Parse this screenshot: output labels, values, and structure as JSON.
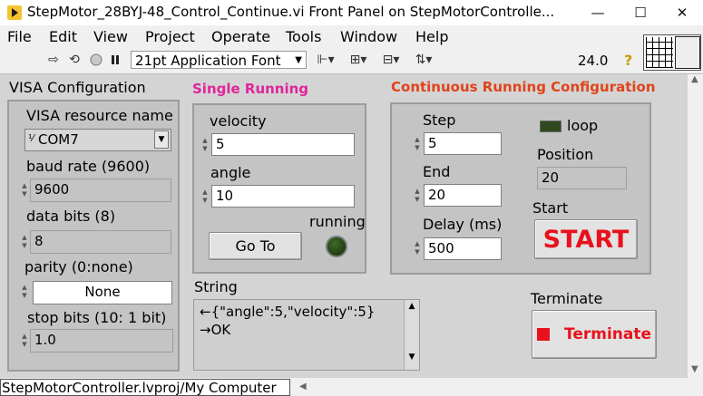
{
  "window": {
    "title": "StepMotor_28BYJ-48_Control_Continue.vi Front Panel on StepMotorControlle...",
    "minimize": "—",
    "maximize": "☐",
    "close": "✕"
  },
  "menu": [
    "File",
    "Edit",
    "View",
    "Project",
    "Operate",
    "Tools",
    "Window",
    "Help"
  ],
  "toolbar": {
    "font": "21pt Application Font",
    "version": "24.0",
    "help": "?"
  },
  "visa": {
    "title": "VISA Configuration",
    "resource_label": "VISA resource name",
    "resource_value": "COM7",
    "baud_label": "baud rate (9600)",
    "baud_value": "9600",
    "databits_label": "data bits (8)",
    "databits_value": "8",
    "parity_label": "parity (0:none)",
    "parity_value": "None",
    "stopbits_label": "stop bits (10: 1 bit)",
    "stopbits_value": "1.0"
  },
  "single": {
    "title": "Single Running",
    "velocity_label": "velocity",
    "velocity_value": "5",
    "angle_label": "angle",
    "angle_value": "10",
    "goto_label": "Go To",
    "running_label": "running"
  },
  "continuous": {
    "title": "Continuous Running Configuration",
    "step_label": "Step",
    "step_value": "5",
    "end_label": "End",
    "end_value": "20",
    "delay_label": "Delay (ms)",
    "delay_value": "500",
    "loop_label": "loop",
    "position_label": "Position",
    "position_value": "20",
    "start_caption": "Start",
    "start_label": "START"
  },
  "string": {
    "label": "String",
    "line1": "←{\"angle\":5,\"velocity\":5}",
    "line2": "→OK"
  },
  "terminate": {
    "caption": "Terminate",
    "label": "Terminate"
  },
  "status": {
    "path": "StepMotorController.lvproj/My Computer"
  },
  "colors": {
    "single_title": "#e0249a",
    "continuous_title": "#e0431a",
    "start_text": "#e8121c",
    "terminate_text": "#e8121c",
    "led_off": "#1f3d12"
  },
  "icons": [
    "run-arrow-icon",
    "run-continuous-icon",
    "abort-icon",
    "pause-icon",
    "align-icon",
    "distribute-icon",
    "resize-icon",
    "reorder-icon",
    "help-icon"
  ]
}
